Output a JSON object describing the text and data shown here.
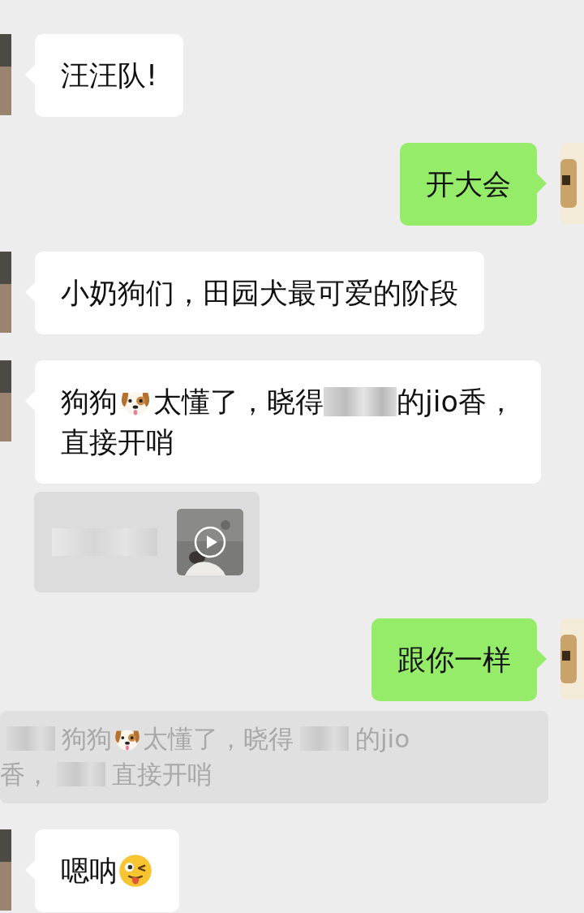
{
  "messages": [
    {
      "kind": "text",
      "outgoing": false,
      "lines": [
        [
          {
            "kind": "text",
            "text": "汪汪队!"
          }
        ]
      ]
    },
    {
      "kind": "text",
      "outgoing": true,
      "lines": [
        [
          {
            "kind": "text",
            "text": "开大会"
          }
        ]
      ]
    },
    {
      "kind": "text",
      "outgoing": false,
      "lines": [
        [
          {
            "kind": "text",
            "text": "小奶狗们，田园犬最可爱的阶段"
          }
        ]
      ]
    },
    {
      "kind": "text",
      "outgoing": false,
      "lines": [
        [
          {
            "kind": "text",
            "text": "狗狗"
          },
          {
            "kind": "dog"
          },
          {
            "kind": "text",
            "text": "太懂了，晓得"
          },
          {
            "kind": "redacted"
          },
          {
            "kind": "text",
            "text": "的jio香，"
          }
        ],
        [
          {
            "kind": "text",
            "text": "直接开哨"
          }
        ]
      ]
    },
    {
      "kind": "video_quote"
    },
    {
      "kind": "text",
      "outgoing": true,
      "lines": [
        [
          {
            "kind": "text",
            "text": "跟你一样"
          }
        ]
      ]
    },
    {
      "kind": "quote",
      "lines": [
        [
          {
            "kind": "redacted"
          },
          {
            "kind": "text",
            "text": "狗狗"
          },
          {
            "kind": "dog"
          },
          {
            "kind": "text",
            "text": "太懂了，晓得"
          },
          {
            "kind": "redacted"
          },
          {
            "kind": "text",
            "text": "的jio"
          }
        ],
        [
          {
            "kind": "text",
            "text": "香，"
          },
          {
            "kind": "redacted"
          },
          {
            "kind": "text",
            "text": "直接开哨"
          }
        ]
      ]
    },
    {
      "kind": "text",
      "outgoing": false,
      "lines": [
        [
          {
            "kind": "text",
            "text": "嗯呐"
          },
          {
            "kind": "wink"
          }
        ]
      ]
    }
  ]
}
